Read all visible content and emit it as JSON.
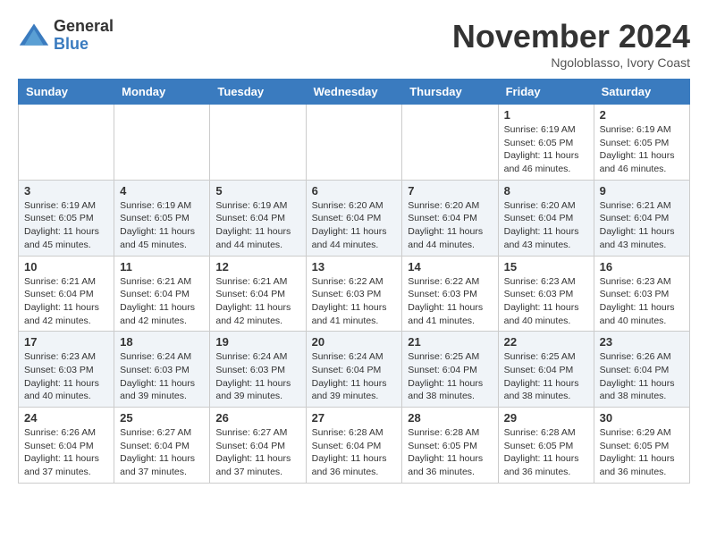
{
  "header": {
    "logo_general": "General",
    "logo_blue": "Blue",
    "month_title": "November 2024",
    "location": "Ngoloblasso, Ivory Coast"
  },
  "calendar": {
    "days_of_week": [
      "Sunday",
      "Monday",
      "Tuesday",
      "Wednesday",
      "Thursday",
      "Friday",
      "Saturday"
    ],
    "weeks": [
      [
        {
          "day": "",
          "info": ""
        },
        {
          "day": "",
          "info": ""
        },
        {
          "day": "",
          "info": ""
        },
        {
          "day": "",
          "info": ""
        },
        {
          "day": "",
          "info": ""
        },
        {
          "day": "1",
          "info": "Sunrise: 6:19 AM\nSunset: 6:05 PM\nDaylight: 11 hours\nand 46 minutes."
        },
        {
          "day": "2",
          "info": "Sunrise: 6:19 AM\nSunset: 6:05 PM\nDaylight: 11 hours\nand 46 minutes."
        }
      ],
      [
        {
          "day": "3",
          "info": "Sunrise: 6:19 AM\nSunset: 6:05 PM\nDaylight: 11 hours\nand 45 minutes."
        },
        {
          "day": "4",
          "info": "Sunrise: 6:19 AM\nSunset: 6:05 PM\nDaylight: 11 hours\nand 45 minutes."
        },
        {
          "day": "5",
          "info": "Sunrise: 6:19 AM\nSunset: 6:04 PM\nDaylight: 11 hours\nand 44 minutes."
        },
        {
          "day": "6",
          "info": "Sunrise: 6:20 AM\nSunset: 6:04 PM\nDaylight: 11 hours\nand 44 minutes."
        },
        {
          "day": "7",
          "info": "Sunrise: 6:20 AM\nSunset: 6:04 PM\nDaylight: 11 hours\nand 44 minutes."
        },
        {
          "day": "8",
          "info": "Sunrise: 6:20 AM\nSunset: 6:04 PM\nDaylight: 11 hours\nand 43 minutes."
        },
        {
          "day": "9",
          "info": "Sunrise: 6:21 AM\nSunset: 6:04 PM\nDaylight: 11 hours\nand 43 minutes."
        }
      ],
      [
        {
          "day": "10",
          "info": "Sunrise: 6:21 AM\nSunset: 6:04 PM\nDaylight: 11 hours\nand 42 minutes."
        },
        {
          "day": "11",
          "info": "Sunrise: 6:21 AM\nSunset: 6:04 PM\nDaylight: 11 hours\nand 42 minutes."
        },
        {
          "day": "12",
          "info": "Sunrise: 6:21 AM\nSunset: 6:04 PM\nDaylight: 11 hours\nand 42 minutes."
        },
        {
          "day": "13",
          "info": "Sunrise: 6:22 AM\nSunset: 6:03 PM\nDaylight: 11 hours\nand 41 minutes."
        },
        {
          "day": "14",
          "info": "Sunrise: 6:22 AM\nSunset: 6:03 PM\nDaylight: 11 hours\nand 41 minutes."
        },
        {
          "day": "15",
          "info": "Sunrise: 6:23 AM\nSunset: 6:03 PM\nDaylight: 11 hours\nand 40 minutes."
        },
        {
          "day": "16",
          "info": "Sunrise: 6:23 AM\nSunset: 6:03 PM\nDaylight: 11 hours\nand 40 minutes."
        }
      ],
      [
        {
          "day": "17",
          "info": "Sunrise: 6:23 AM\nSunset: 6:03 PM\nDaylight: 11 hours\nand 40 minutes."
        },
        {
          "day": "18",
          "info": "Sunrise: 6:24 AM\nSunset: 6:03 PM\nDaylight: 11 hours\nand 39 minutes."
        },
        {
          "day": "19",
          "info": "Sunrise: 6:24 AM\nSunset: 6:03 PM\nDaylight: 11 hours\nand 39 minutes."
        },
        {
          "day": "20",
          "info": "Sunrise: 6:24 AM\nSunset: 6:04 PM\nDaylight: 11 hours\nand 39 minutes."
        },
        {
          "day": "21",
          "info": "Sunrise: 6:25 AM\nSunset: 6:04 PM\nDaylight: 11 hours\nand 38 minutes."
        },
        {
          "day": "22",
          "info": "Sunrise: 6:25 AM\nSunset: 6:04 PM\nDaylight: 11 hours\nand 38 minutes."
        },
        {
          "day": "23",
          "info": "Sunrise: 6:26 AM\nSunset: 6:04 PM\nDaylight: 11 hours\nand 38 minutes."
        }
      ],
      [
        {
          "day": "24",
          "info": "Sunrise: 6:26 AM\nSunset: 6:04 PM\nDaylight: 11 hours\nand 37 minutes."
        },
        {
          "day": "25",
          "info": "Sunrise: 6:27 AM\nSunset: 6:04 PM\nDaylight: 11 hours\nand 37 minutes."
        },
        {
          "day": "26",
          "info": "Sunrise: 6:27 AM\nSunset: 6:04 PM\nDaylight: 11 hours\nand 37 minutes."
        },
        {
          "day": "27",
          "info": "Sunrise: 6:28 AM\nSunset: 6:04 PM\nDaylight: 11 hours\nand 36 minutes."
        },
        {
          "day": "28",
          "info": "Sunrise: 6:28 AM\nSunset: 6:05 PM\nDaylight: 11 hours\nand 36 minutes."
        },
        {
          "day": "29",
          "info": "Sunrise: 6:28 AM\nSunset: 6:05 PM\nDaylight: 11 hours\nand 36 minutes."
        },
        {
          "day": "30",
          "info": "Sunrise: 6:29 AM\nSunset: 6:05 PM\nDaylight: 11 hours\nand 36 minutes."
        }
      ]
    ]
  }
}
